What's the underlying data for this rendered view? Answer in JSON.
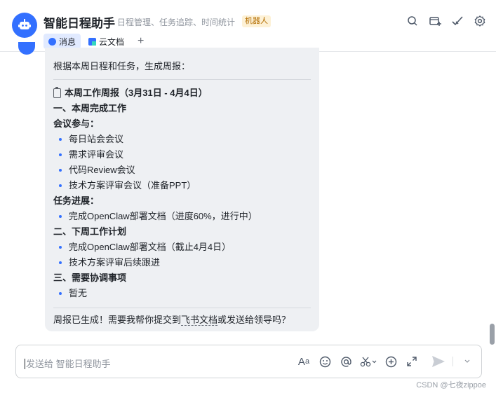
{
  "header": {
    "title": "智能日程助手",
    "subtitle": "日程管理、任务追踪、时间统计",
    "badge": "机器人",
    "icons": [
      "search-icon",
      "add-window-icon",
      "check-icon",
      "gear-icon"
    ]
  },
  "tabs": [
    {
      "label": "消息",
      "active": true
    },
    {
      "label": "云文档",
      "active": false
    }
  ],
  "message": {
    "intro": "根据本周日程和任务，生成周报：",
    "report_title": "本周工作周报（3月31日 - 4月4日）",
    "section1": "一、本周完成工作",
    "meetings_label": "会议参与：",
    "meetings": [
      "每日站会会议",
      "需求评审会议",
      "代码Review会议",
      "技术方案评审会议（准备PPT）"
    ],
    "progress_label": "任务进展：",
    "progress": [
      "完成OpenClaw部署文档（进度60%，进行中）"
    ],
    "section2": "二、下周工作计划",
    "next_week": [
      "完成OpenClaw部署文档（截止4月4日）",
      "技术方案评审后续跟进"
    ],
    "section3": "三、需要协调事项",
    "coordination": [
      "暂无"
    ],
    "footer_before": "周报已生成！需要我帮你提交到",
    "footer_link": "飞书文档",
    "footer_after": "或发送给领导吗？"
  },
  "input": {
    "placeholder": "发送给 智能日程助手"
  },
  "watermark": "CSDN @七夜zippoe",
  "colors": {
    "accent": "#3370ff",
    "bubble": "#eef0f3",
    "badge_bg": "#fdf1d6",
    "badge_text": "#b36d00"
  }
}
